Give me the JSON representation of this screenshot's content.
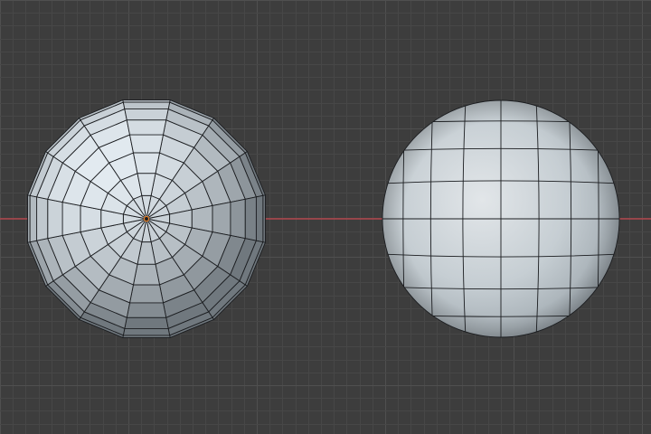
{
  "viewport": {
    "theme": {
      "background": "#3d3d3d",
      "grid_minor": "#474747",
      "grid_major": "#4f4f4f",
      "x_axis": "#c9474f",
      "wire": "#1b1d20",
      "origin": "#e8832a"
    }
  },
  "objects": [
    {
      "name": "low-poly-sphere",
      "shading": "flat",
      "selected": true,
      "base_color": "#b8c0c6"
    },
    {
      "name": "subdivided-sphere",
      "shading": "smooth",
      "selected": false,
      "base_color": "#c2cacf"
    }
  ]
}
